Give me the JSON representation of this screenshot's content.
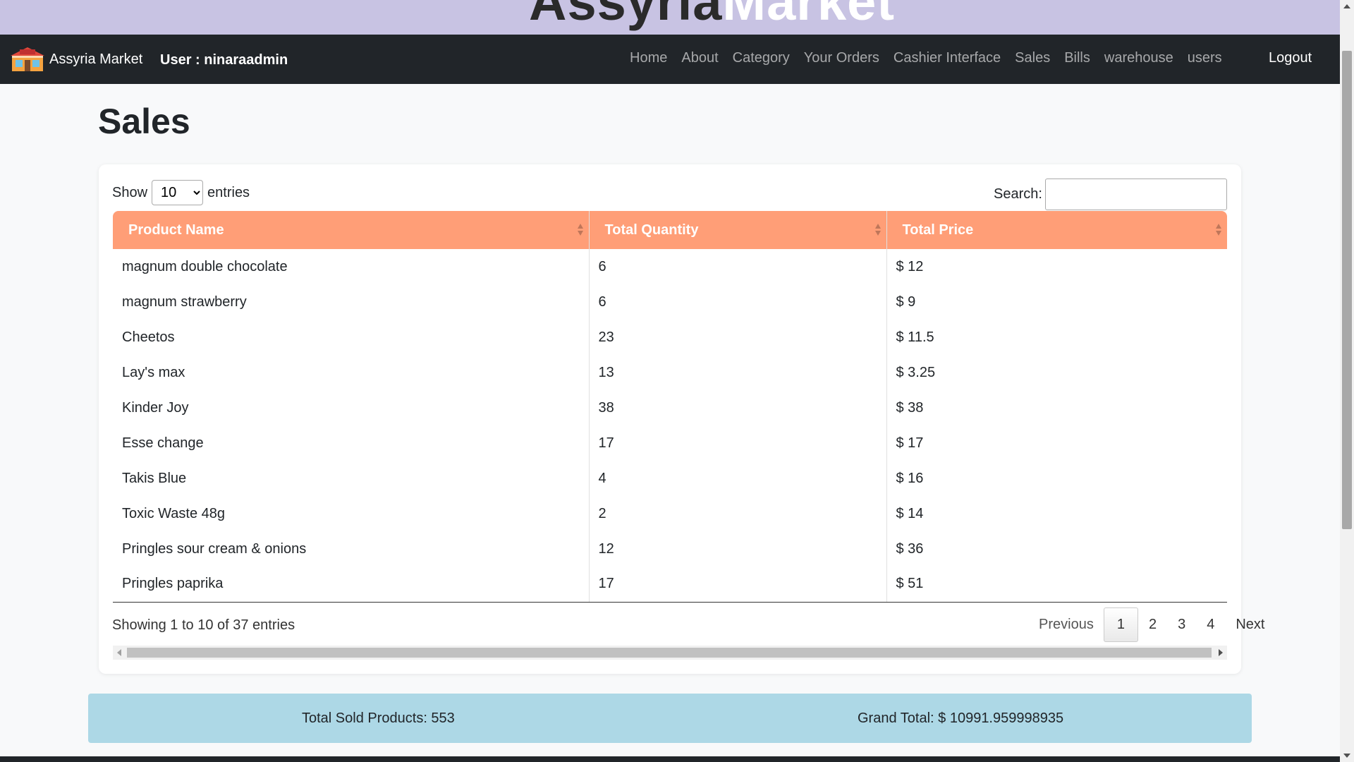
{
  "banner": {
    "brand_part1": "Assyria",
    "brand_part2": "Market"
  },
  "navbar": {
    "brand": "Assyria Market",
    "user_label": "User : ninaraadmin",
    "links": [
      "Home",
      "About",
      "Category",
      "Your Orders",
      "Cashier Interface",
      "Sales",
      "Bills",
      "warehouse",
      "users"
    ],
    "logout": "Logout"
  },
  "page": {
    "title": "Sales"
  },
  "table_controls": {
    "show_label": "Show",
    "entries_value": "10",
    "entries_label": "entries",
    "search_label": "Search:",
    "search_value": ""
  },
  "table": {
    "headers": [
      "Product Name",
      "Total Quantity",
      "Total Price"
    ],
    "rows": [
      [
        "magnum double chocolate",
        "6",
        "$ 12"
      ],
      [
        "magnum strawberry",
        "6",
        "$ 9"
      ],
      [
        "Cheetos",
        "23",
        "$ 11.5"
      ],
      [
        "Lay's max",
        "13",
        "$ 3.25"
      ],
      [
        "Kinder Joy",
        "38",
        "$ 38"
      ],
      [
        "Esse change",
        "17",
        "$ 17"
      ],
      [
        "Takis Blue",
        "4",
        "$ 16"
      ],
      [
        "Toxic Waste 48g",
        "2",
        "$ 14"
      ],
      [
        "Pringles sour cream & onions",
        "12",
        "$ 36"
      ],
      [
        "Pringles paprika",
        "17",
        "$ 51"
      ]
    ]
  },
  "footer": {
    "info": "Showing 1 to 10 of 37 entries",
    "previous": "Previous",
    "pages": [
      "1",
      "2",
      "3",
      "4"
    ],
    "active_page": "1",
    "next": "Next"
  },
  "totals": {
    "sold": "Total Sold Products: 553",
    "grand": "Grand Total: $ 10991.959998935"
  },
  "colors": {
    "banner": "#c8c3e3",
    "navbar": "#212529",
    "table_header": "#ff9e77",
    "totals": "#add8e6"
  }
}
